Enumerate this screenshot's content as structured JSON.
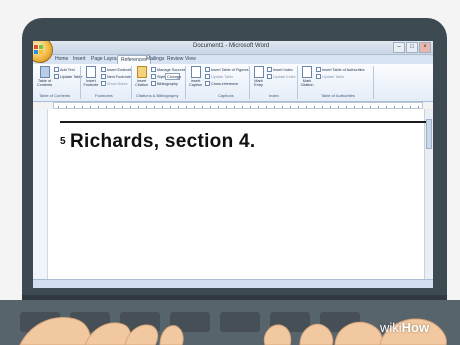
{
  "window": {
    "title": "Document1 - Microsoft Word",
    "buttons": [
      "–",
      "□",
      "×"
    ]
  },
  "tabs": [
    {
      "label": "Home"
    },
    {
      "label": "Insert"
    },
    {
      "label": "Page Layout"
    },
    {
      "label": "References",
      "active": true
    },
    {
      "label": "Mailings"
    },
    {
      "label": "Review"
    },
    {
      "label": "View"
    }
  ],
  "ribbon": {
    "toc": {
      "big_label": "Table of Contents",
      "add_text": "Add Text",
      "update_table": "Update Table",
      "group": "Table of Contents"
    },
    "footnotes": {
      "big_label": "Insert Footnote",
      "insert_endnote": "Insert Endnote",
      "next_footnote": "Next Footnote",
      "show_notes": "Show Notes",
      "group": "Footnotes"
    },
    "citations": {
      "big_label": "Insert Citation",
      "manage_sources": "Manage Sources",
      "style_label": "Style:",
      "style_value": "Chicago",
      "bibliography": "Bibliography",
      "group": "Citations & Bibliography"
    },
    "captions": {
      "big_label": "Insert Caption",
      "insert_table_of_figures": "Insert Table of Figures",
      "update_table": "Update Table",
      "cross_reference": "Cross-reference",
      "group": "Captions"
    },
    "index": {
      "big_label": "Mark Entry",
      "insert_index": "Insert Index",
      "update_index": "Update Index",
      "group": "Index"
    },
    "authorities": {
      "big_label": "Mark Citation",
      "insert_toa": "Insert Table of Authorities",
      "update_table": "Update Table",
      "group": "Table of Authorities"
    }
  },
  "document": {
    "footnote_number": "5",
    "footnote_text": "Richards, section 4."
  },
  "watermark": {
    "prefix": "wiki",
    "suffix": "How"
  },
  "colors": {
    "laptop": "#3e4a52",
    "ribbon_bg": "#e4edf8",
    "tab_bar": "#d7e3f1",
    "skin": "#f2c8a0"
  }
}
